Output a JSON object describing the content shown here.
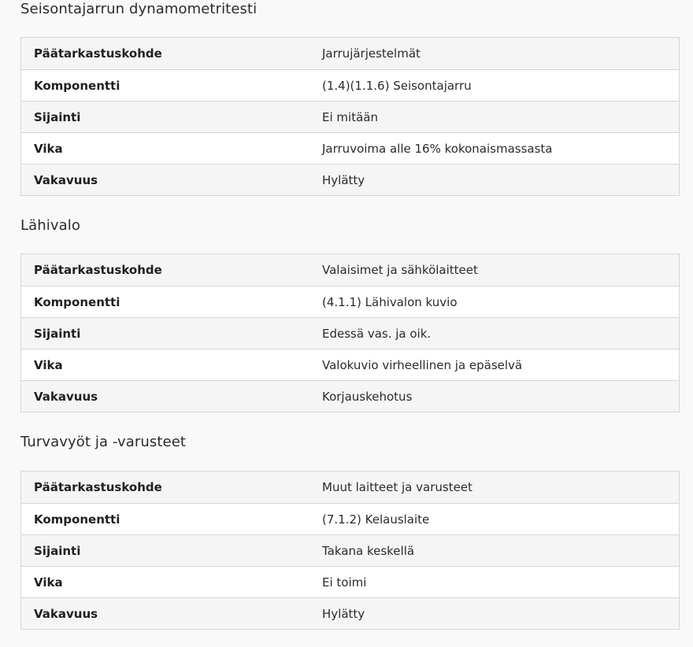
{
  "sections": [
    {
      "title": "Seisontajarrun dynamometritesti",
      "rows": [
        {
          "label": "Päätarkastuskohde",
          "value": "Jarrujärjestelmät"
        },
        {
          "label": "Komponentti",
          "value": "(1.4)(1.1.6) Seisontajarru"
        },
        {
          "label": "Sijainti",
          "value": "Ei mitään"
        },
        {
          "label": "Vika",
          "value": "Jarruvoima alle 16% kokonaismassasta"
        },
        {
          "label": "Vakavuus",
          "value": "Hylätty"
        }
      ]
    },
    {
      "title": "Lähivalo",
      "rows": [
        {
          "label": "Päätarkastuskohde",
          "value": "Valaisimet ja sähkölaitteet"
        },
        {
          "label": "Komponentti",
          "value": "(4.1.1) Lähivalon kuvio"
        },
        {
          "label": "Sijainti",
          "value": "Edessä vas. ja oik."
        },
        {
          "label": "Vika",
          "value": "Valokuvio virheellinen ja epäselvä"
        },
        {
          "label": "Vakavuus",
          "value": "Korjauskehotus"
        }
      ]
    },
    {
      "title": "Turvavyöt ja -varusteet",
      "rows": [
        {
          "label": "Päätarkastuskohde",
          "value": "Muut laitteet ja varusteet"
        },
        {
          "label": "Komponentti",
          "value": "(7.1.2) Kelauslaite"
        },
        {
          "label": "Sijainti",
          "value": "Takana keskellä"
        },
        {
          "label": "Vika",
          "value": "Ei toimi"
        },
        {
          "label": "Vakavuus",
          "value": "Hylätty"
        }
      ]
    }
  ]
}
